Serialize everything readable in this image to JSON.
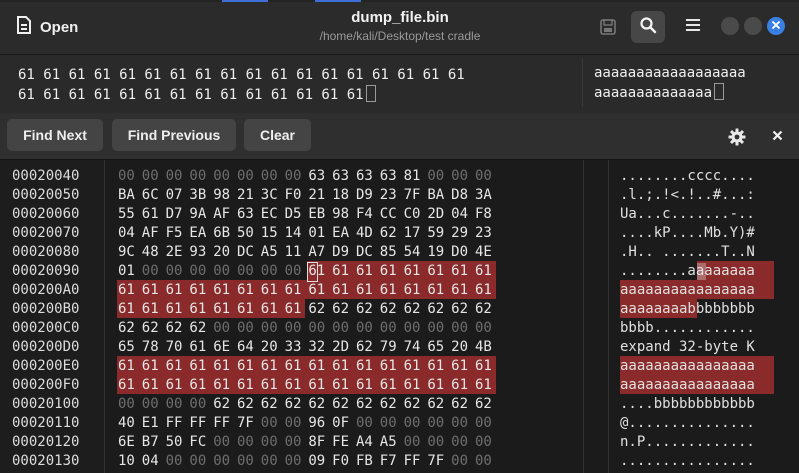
{
  "header": {
    "open_label": "Open",
    "title": "dump_file.bin",
    "path": "/home/kali/Desktop/test cradle"
  },
  "search": {
    "hex_line1": "61 61 61 61 61 61 61 61 61 61 61 61 61 61 61 61 61 61",
    "hex_line2": "61 61 61 61 61 61 61 61 61 61 61 61 61 61",
    "text_line1": "aaaaaaaaaaaaaaaaaa",
    "text_line2": "aaaaaaaaaaaaaa"
  },
  "toolbar": {
    "find_next": "Find Next",
    "find_previous": "Find Previous",
    "clear": "Clear"
  },
  "rows": [
    {
      "addr": "00020040",
      "bytes": [
        "00",
        "00",
        "00",
        "00",
        "00",
        "00",
        "00",
        "00",
        "63",
        "63",
        "63",
        "63",
        "81",
        "00",
        "00",
        "00"
      ],
      "ascii": "........cccc...."
    },
    {
      "addr": "00020050",
      "bytes": [
        "BA",
        "6C",
        "07",
        "3B",
        "98",
        "21",
        "3C",
        "F0",
        "21",
        "18",
        "D9",
        "23",
        "7F",
        "BA",
        "D8",
        "3A"
      ],
      "ascii": ".l.;.!<.!..#...:"
    },
    {
      "addr": "00020060",
      "bytes": [
        "55",
        "61",
        "D7",
        "9A",
        "AF",
        "63",
        "EC",
        "D5",
        "EB",
        "98",
        "F4",
        "CC",
        "C0",
        "2D",
        "04",
        "F8"
      ],
      "ascii": "Ua...c.......-.."
    },
    {
      "addr": "00020070",
      "bytes": [
        "04",
        "AF",
        "F5",
        "EA",
        "6B",
        "50",
        "15",
        "14",
        "01",
        "EA",
        "4D",
        "62",
        "17",
        "59",
        "29",
        "23"
      ],
      "ascii": "....kP....Mb.Y)#"
    },
    {
      "addr": "00020080",
      "bytes": [
        "9C",
        "48",
        "2E",
        "93",
        "20",
        "DC",
        "A5",
        "11",
        "A7",
        "D9",
        "DC",
        "85",
        "54",
        "19",
        "D0",
        "4E"
      ],
      "ascii": ".H.. .......T..N"
    },
    {
      "addr": "00020090",
      "bytes": [
        "01",
        "00",
        "00",
        "00",
        "00",
        "00",
        "00",
        "00",
        "61",
        "61",
        "61",
        "61",
        "61",
        "61",
        "61",
        "61"
      ],
      "ascii": "........aaaaaaaa"
    },
    {
      "addr": "000200A0",
      "bytes": [
        "61",
        "61",
        "61",
        "61",
        "61",
        "61",
        "61",
        "61",
        "61",
        "61",
        "61",
        "61",
        "61",
        "61",
        "61",
        "61"
      ],
      "ascii": "aaaaaaaaaaaaaaaa"
    },
    {
      "addr": "000200B0",
      "bytes": [
        "61",
        "61",
        "61",
        "61",
        "61",
        "61",
        "61",
        "61",
        "62",
        "62",
        "62",
        "62",
        "62",
        "62",
        "62",
        "62"
      ],
      "ascii": "aaaaaaaabbbbbbbb"
    },
    {
      "addr": "000200C0",
      "bytes": [
        "62",
        "62",
        "62",
        "62",
        "00",
        "00",
        "00",
        "00",
        "00",
        "00",
        "00",
        "00",
        "00",
        "00",
        "00",
        "00"
      ],
      "ascii": "bbbb............"
    },
    {
      "addr": "000200D0",
      "bytes": [
        "65",
        "78",
        "70",
        "61",
        "6E",
        "64",
        "20",
        "33",
        "32",
        "2D",
        "62",
        "79",
        "74",
        "65",
        "20",
        "4B"
      ],
      "ascii": "expand 32-byte K"
    },
    {
      "addr": "000200E0",
      "bytes": [
        "61",
        "61",
        "61",
        "61",
        "61",
        "61",
        "61",
        "61",
        "61",
        "61",
        "61",
        "61",
        "61",
        "61",
        "61",
        "61"
      ],
      "ascii": "aaaaaaaaaaaaaaaa"
    },
    {
      "addr": "000200F0",
      "bytes": [
        "61",
        "61",
        "61",
        "61",
        "61",
        "61",
        "61",
        "61",
        "61",
        "61",
        "61",
        "61",
        "61",
        "61",
        "61",
        "61"
      ],
      "ascii": "aaaaaaaaaaaaaaaa"
    },
    {
      "addr": "00020100",
      "bytes": [
        "00",
        "00",
        "00",
        "00",
        "62",
        "62",
        "62",
        "62",
        "62",
        "62",
        "62",
        "62",
        "62",
        "62",
        "62",
        "62"
      ],
      "ascii": "....bbbbbbbbbbbb"
    },
    {
      "addr": "00020110",
      "bytes": [
        "40",
        "E1",
        "FF",
        "FF",
        "FF",
        "7F",
        "00",
        "00",
        "96",
        "0F",
        "00",
        "00",
        "00",
        "00",
        "00",
        "00"
      ],
      "ascii": "@..............."
    },
    {
      "addr": "00020120",
      "bytes": [
        "6E",
        "B7",
        "50",
        "FC",
        "00",
        "00",
        "00",
        "00",
        "8F",
        "FE",
        "A4",
        "A5",
        "00",
        "00",
        "00",
        "00"
      ],
      "ascii": "n.P............."
    },
    {
      "addr": "00020130",
      "bytes": [
        "10",
        "04",
        "00",
        "00",
        "00",
        "00",
        "00",
        "00",
        "09",
        "F0",
        "FB",
        "F7",
        "FF",
        "7F",
        "00",
        "00"
      ],
      "ascii": "................"
    }
  ],
  "highlights": [
    {
      "row": 5,
      "start": 8,
      "end": 16
    },
    {
      "row": 6,
      "start": 0,
      "end": 16
    },
    {
      "row": 7,
      "start": 0,
      "end": 8
    },
    {
      "row": 10,
      "start": 0,
      "end": 16
    },
    {
      "row": 11,
      "start": 0,
      "end": 16
    }
  ],
  "caret": {
    "row": 5,
    "col": 8
  },
  "colors": {
    "highlight": "#8a2a2a",
    "accent": "#3b7fe0",
    "zero_byte": "#6e6e6e"
  },
  "icons": [
    "open-file-icon",
    "save-icon",
    "search-icon",
    "menu-icon",
    "minimize-button",
    "maximize-button",
    "close-icon",
    "settings-icon",
    "close-search-icon"
  ]
}
